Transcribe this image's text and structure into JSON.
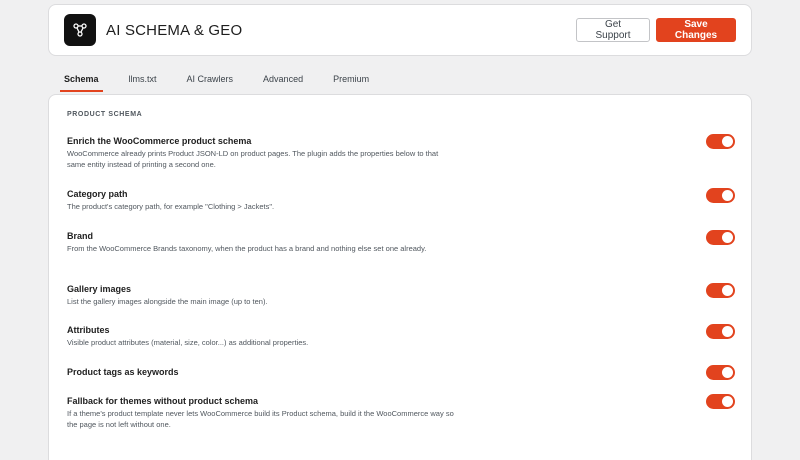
{
  "header": {
    "title": "AI SCHEMA & GEO",
    "logo_icon": "share-nodes-icon",
    "support_label": "Get Support",
    "save_label": "Save Changes"
  },
  "colors": {
    "accent": "#e2431e",
    "logo_bg": "#111111",
    "text": "#1e1e1e",
    "muted": "#50575e"
  },
  "tabs": [
    {
      "label": "Schema",
      "active": true
    },
    {
      "label": "llms.txt",
      "active": false
    },
    {
      "label": "AI Crawlers",
      "active": false
    },
    {
      "label": "Advanced",
      "active": false
    },
    {
      "label": "Premium",
      "active": false
    }
  ],
  "section": {
    "title": "PRODUCT SCHEMA",
    "settings": [
      {
        "label": "Enrich the WooCommerce product schema",
        "description": "WooCommerce already prints Product JSON-LD on product pages. The plugin adds the properties below to that same entity instead of printing a second one.",
        "enabled": true
      },
      {
        "label": "Category path",
        "description": "The product's category path, for example \"Clothing > Jackets\".",
        "enabled": true
      },
      {
        "label": "Brand",
        "description": "From the WooCommerce Brands taxonomy, when the product has a brand and nothing else set one already.",
        "enabled": true
      },
      {
        "label": "Gallery images",
        "description": "List the gallery images alongside the main image (up to ten).",
        "enabled": true
      },
      {
        "label": "Attributes",
        "description": "Visible product attributes (material, size, color...) as additional properties.",
        "enabled": true
      },
      {
        "label": "Product tags as keywords",
        "description": "",
        "enabled": true
      },
      {
        "label": "Fallback for themes without product schema",
        "description": "If a theme's product template never lets WooCommerce build its Product schema, build it the WooCommerce way so the page is not left without one.",
        "enabled": true
      }
    ]
  }
}
